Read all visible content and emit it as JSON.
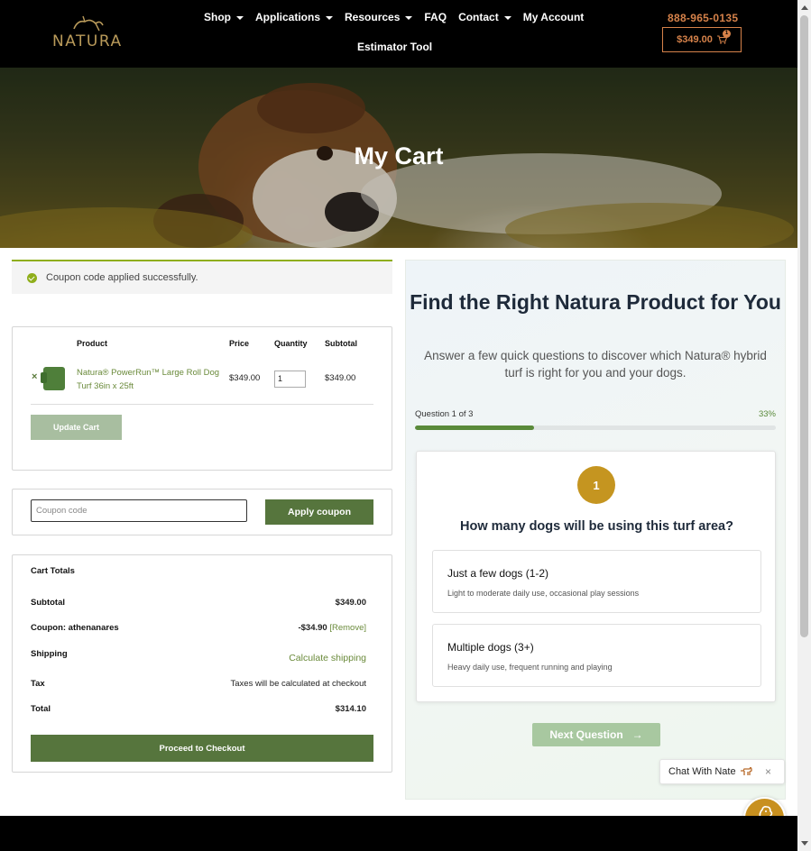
{
  "header": {
    "logo_text": "NATURA",
    "nav": [
      {
        "label": "Shop",
        "dropdown": true
      },
      {
        "label": "Applications",
        "dropdown": true
      },
      {
        "label": "Resources",
        "dropdown": true
      },
      {
        "label": "FAQ",
        "dropdown": false
      },
      {
        "label": "Contact",
        "dropdown": true
      },
      {
        "label": "My Account",
        "dropdown": false
      }
    ],
    "nav_second_row": "Estimator Tool",
    "phone": "888-965-0135",
    "cart_total": "$349.00",
    "cart_count": "1",
    "accent_color": "#d6824a"
  },
  "hero": {
    "title": "My Cart"
  },
  "notice": {
    "text": "Coupon code applied successfully."
  },
  "cart_table": {
    "headers": {
      "product": "Product",
      "price": "Price",
      "quantity": "Quantity",
      "subtotal": "Subtotal"
    },
    "rows": [
      {
        "remove": "×",
        "name": "Natura® PowerRun™ Large Roll Dog Turf 36in x 25ft",
        "price": "$349.00",
        "quantity": "1",
        "subtotal": "$349.00"
      }
    ],
    "update_label": "Update Cart"
  },
  "coupon": {
    "placeholder": "Coupon code",
    "apply_label": "Apply coupon"
  },
  "totals": {
    "title": "Cart Totals",
    "subtotal_label": "Subtotal",
    "subtotal_value": "$349.00",
    "coupon_label": "Coupon: athenanares",
    "coupon_value": "-$34.90",
    "coupon_remove": "[Remove]",
    "shipping_label": "Shipping",
    "shipping_value": "Calculate shipping",
    "tax_label": "Tax",
    "tax_value": "Taxes will be calculated at checkout",
    "total_label": "Total",
    "total_value": "$314.10",
    "checkout_label": "Proceed to Checkout"
  },
  "quiz": {
    "title": "Find the Right Natura Product for You",
    "subtitle": "Answer a few quick questions to discover which Natura® hybrid turf is right for you and your dogs.",
    "progress_label": "Question 1 of 3",
    "progress_pct_label": "33%",
    "progress_fraction": 0.33,
    "question_number": "1",
    "question": "How many dogs will be using this turf area?",
    "options": [
      {
        "title": "Just a few dogs (1-2)",
        "desc": "Light to moderate daily use, occasional play sessions"
      },
      {
        "title": "Multiple dogs (3+)",
        "desc": "Heavy daily use, frequent running and playing"
      }
    ],
    "next_label": "Next Question",
    "next_arrow": "→"
  },
  "chat": {
    "label": "Chat With Nate",
    "close": "×"
  }
}
